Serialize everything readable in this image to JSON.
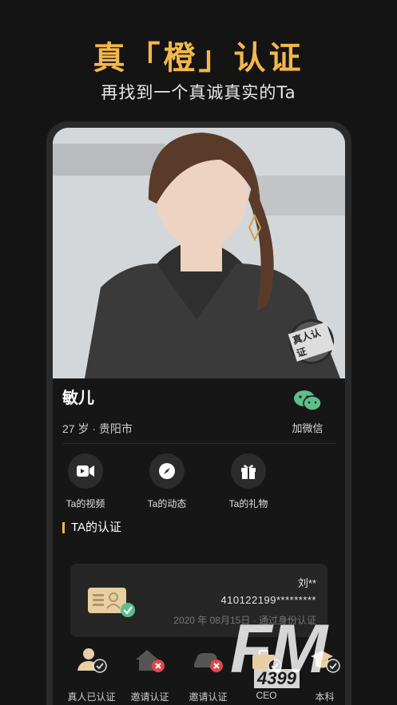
{
  "hero": {
    "title": "真「橙」认证",
    "subtitle": "再找到一个真诚真实的Ta"
  },
  "profile": {
    "stamp": "真人认证",
    "name": "敏儿",
    "meta": "27 岁 · 贵阳市",
    "wechat_label": "加微信"
  },
  "actions": [
    {
      "label": "Ta的视频",
      "icon": "video-icon"
    },
    {
      "label": "Ta的动态",
      "icon": "compass-icon"
    },
    {
      "label": "Ta的礼物",
      "icon": "gift-icon"
    }
  ],
  "certification": {
    "section_title": "TA的认证",
    "card": {
      "name": "刘**",
      "id_number": "410122199*********",
      "date_text": "2020 年 08月15日 · 通过身份认证"
    }
  },
  "badges": [
    {
      "label": "真人已认证",
      "icon": "person-check-icon",
      "status": "verified"
    },
    {
      "label": "邀请认证",
      "icon": "house-icon",
      "status": "unverified"
    },
    {
      "label": "邀请认证",
      "icon": "car-icon",
      "status": "unverified"
    },
    {
      "label": "CEO",
      "icon": "briefcase-icon",
      "status": "verified"
    },
    {
      "label": "本科",
      "icon": "graduation-cap-icon",
      "status": "verified"
    }
  ],
  "watermark": {
    "main": "FM",
    "sub": "4399"
  },
  "colors": {
    "accent": "#f2b84b",
    "background": "#141414",
    "verified": "#5bbf8a",
    "unverified": "#e0474c"
  }
}
